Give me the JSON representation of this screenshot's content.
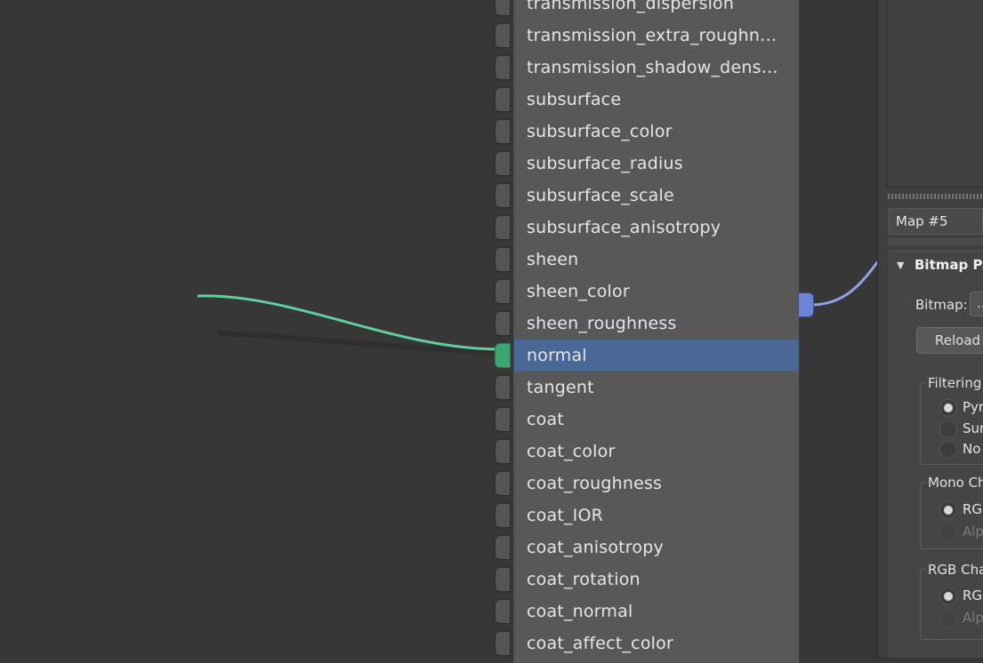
{
  "node": {
    "ports": [
      {
        "label": "transmission_dispersion"
      },
      {
        "label": "transmission_extra_roughn…"
      },
      {
        "label": "transmission_shadow_dens…"
      },
      {
        "label": "subsurface"
      },
      {
        "label": "subsurface_color"
      },
      {
        "label": "subsurface_radius"
      },
      {
        "label": "subsurface_scale"
      },
      {
        "label": "subsurface_anisotropy"
      },
      {
        "label": "sheen"
      },
      {
        "label": "sheen_color"
      },
      {
        "label": "sheen_roughness"
      },
      {
        "label": "normal",
        "selected": true,
        "connected": true
      },
      {
        "label": "tangent"
      },
      {
        "label": "coat"
      },
      {
        "label": "coat_color"
      },
      {
        "label": "coat_roughness"
      },
      {
        "label": "coat_IOR"
      },
      {
        "label": "coat_anisotropy"
      },
      {
        "label": "coat_rotation"
      },
      {
        "label": "coat_normal"
      },
      {
        "label": "coat_affect_color"
      }
    ]
  },
  "colors": {
    "wire_in": "#5fcf9c",
    "wire_out": "#8ea4e8",
    "selected_row": "#4a6896"
  },
  "panel": {
    "map_name": "Map #5",
    "rollout_title": "Bitmap Pa",
    "bitmap_label": "Bitmap:",
    "bitmap_button": "…",
    "reload_button": "Reload",
    "filtering": {
      "title": "Filtering",
      "options": [
        {
          "label": "Pyr",
          "selected": true
        },
        {
          "label": "Sur",
          "selected": false
        },
        {
          "label": "No",
          "selected": false
        }
      ]
    },
    "mono": {
      "title": "Mono Ch",
      "options": [
        {
          "label": "RG",
          "selected": true
        },
        {
          "label": "Alp",
          "selected": false,
          "disabled": true
        }
      ]
    },
    "rgb": {
      "title": "RGB Cha",
      "options": [
        {
          "label": "RG",
          "selected": true
        },
        {
          "label": "Alp",
          "selected": false,
          "disabled": true
        }
      ]
    }
  }
}
